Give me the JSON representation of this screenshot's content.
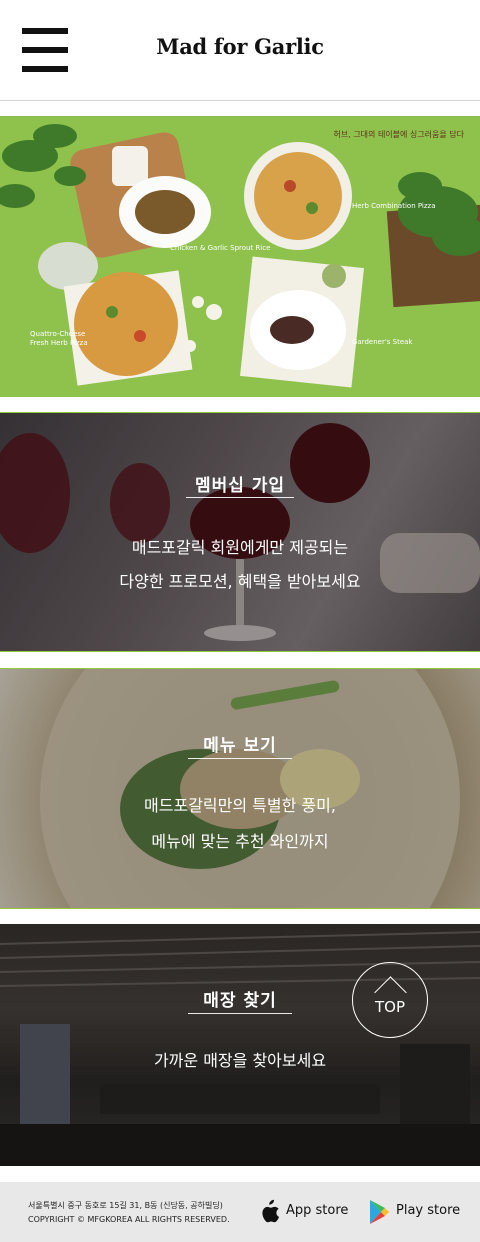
{
  "header": {
    "menu_icon": "hamburger-menu-icon",
    "logo_text": "Mad for Garlic"
  },
  "hero": {
    "tagline": "허브, 그대의 테이블에 싱그러움을 담다",
    "captions": {
      "chicken": "Chicken & Garlic Sprout Rice",
      "herb_combination": "Herb Combination Pizza",
      "quattro_line1": "Quattro-Cheese",
      "quattro_line2": "Fresh Herb Pizza",
      "steak": "Gardener's Steak"
    },
    "background_color": "#8fc24d"
  },
  "cards": [
    {
      "title": "멤버십 가입",
      "desc_line1": "매드포갈릭 회원에게만 제공되는",
      "desc_line2": "다양한 프로모션, 혜택을 받아보세요"
    },
    {
      "title": "메뉴 보기",
      "desc_line1": "매드포갈릭만의 특별한 풍미,",
      "desc_line2": "메뉴에 맞는 추천 와인까지"
    },
    {
      "title": "매장 찾기",
      "desc_line1": "가까운 매장을 찾아보세요"
    }
  ],
  "top_button": {
    "label": "TOP",
    "icon": "chevron-up-icon"
  },
  "footer": {
    "address": "서울특별시 중구 동호로 15길 31, B동 (신당동, 공하빌딩)",
    "copyright": "COPYRIGHT © MFGKOREA ALL RIGHTS RESERVED.",
    "app_store_label": "App store",
    "app_store_icon": "apple-icon",
    "play_store_label": "Play store",
    "play_store_icon": "google-play-icon"
  },
  "colors": {
    "accent_green": "#93c83d",
    "footer_bg": "#e8e8e8"
  }
}
